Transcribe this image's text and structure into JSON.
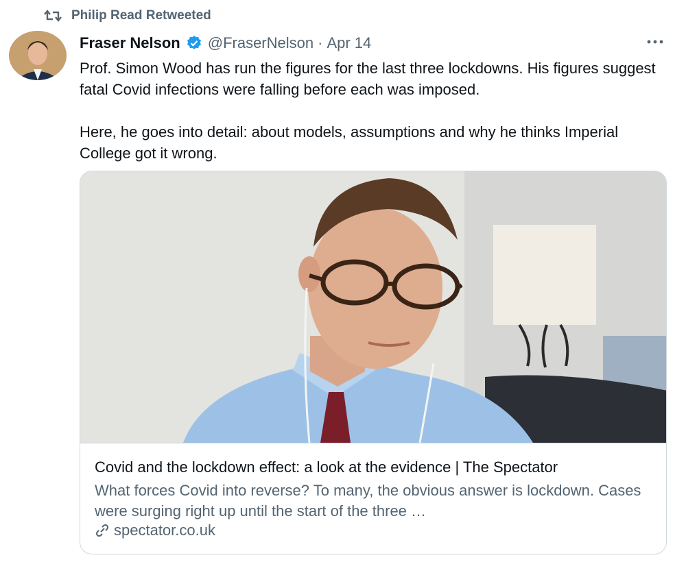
{
  "retweet": {
    "label": "Philip Read Retweeted",
    "icon": "retweet-icon"
  },
  "author": {
    "name": "Fraser Nelson",
    "handle": "@FraserNelson",
    "separator": "·",
    "date": "Apr 14",
    "verified_color": "#1d9bf0"
  },
  "tweet": {
    "text": "Prof. Simon Wood has run the figures for the last three lockdowns. His figures suggest fatal Covid infections were falling before each was imposed.\n\nHere, he goes into detail: about models,  assumptions and why he thinks Imperial College got it wrong."
  },
  "card": {
    "title": "Covid and the lockdown effect: a look at the evidence | The Spectator",
    "description": "What forces Covid into reverse? To many, the obvious answer is lockdown. Cases were surging right up until the start of the three …",
    "domain": "spectator.co.uk"
  },
  "colors": {
    "secondary_text": "#536471",
    "border": "#cfd9de",
    "primary_text": "#0f1419"
  }
}
